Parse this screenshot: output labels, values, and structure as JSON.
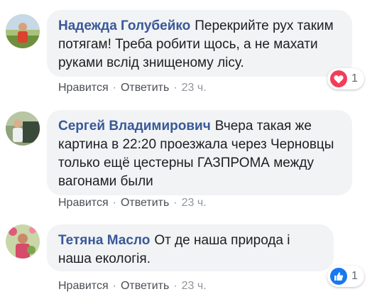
{
  "comments": [
    {
      "author": "Надежда Голубейко",
      "text": "Перекрийте рух таким потягам! Треба робити щось, а не махати руками вслід знищеному лісу.",
      "like_label": "Нравится",
      "reply_label": "Ответить",
      "time": "23 ч.",
      "reaction": {
        "type": "love",
        "icon": "heart-icon",
        "count": "1",
        "color": "#f33e58"
      }
    },
    {
      "author": "Сергей Владимирович",
      "text": "Вчера такая же картина в 22:20 проезжала через Черновцы только ещё цестерны ГАЗПРОМА между вагонами были",
      "like_label": "Нравится",
      "reply_label": "Ответить",
      "time": "23 ч."
    },
    {
      "author": "Тетяна Масло",
      "text": "От де наша природа і наша екологія.",
      "like_label": "Нравится",
      "reply_label": "Ответить",
      "time": "23 ч.",
      "reaction": {
        "type": "like",
        "icon": "thumbs-up-icon",
        "count": "1",
        "color": "#1877f2"
      }
    }
  ],
  "colors": {
    "author": "#385898",
    "bubble_bg": "#f2f3f5",
    "meta": "#90949c"
  }
}
